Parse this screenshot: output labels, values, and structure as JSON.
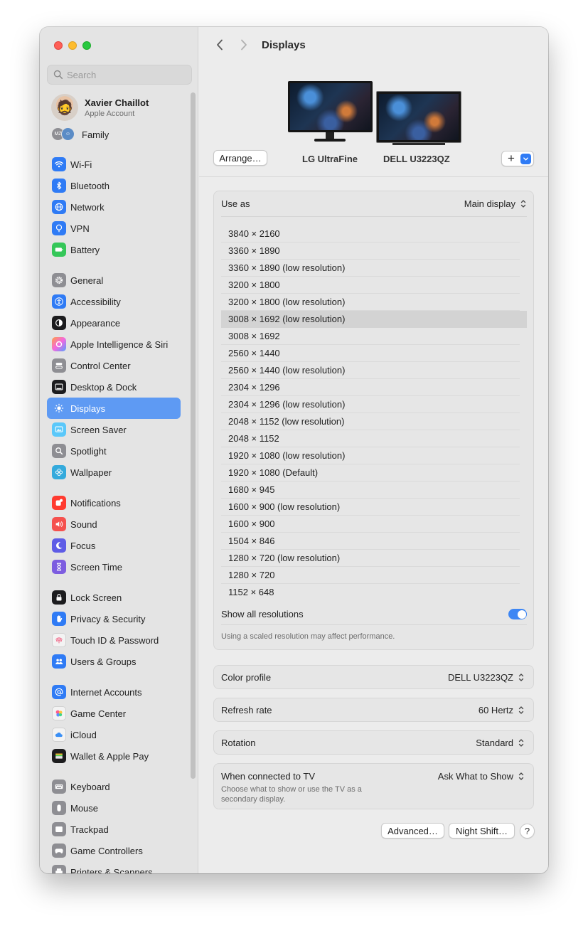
{
  "sidebar": {
    "search_placeholder": "Search",
    "account": {
      "name": "Xavier Chaillot",
      "subtitle": "Apple Account"
    },
    "family": {
      "label": "Family",
      "avatar_initials": "MZ"
    },
    "items": [
      {
        "label": "Wi-Fi",
        "icon": "wifi-icon"
      },
      {
        "label": "Bluetooth",
        "icon": "bluetooth-icon"
      },
      {
        "label": "Network",
        "icon": "globe-icon"
      },
      {
        "label": "VPN",
        "icon": "vpn-icon"
      },
      {
        "label": "Battery",
        "icon": "battery-icon"
      },
      {
        "label": "General",
        "icon": "gear-icon"
      },
      {
        "label": "Accessibility",
        "icon": "accessibility-icon"
      },
      {
        "label": "Appearance",
        "icon": "appearance-icon"
      },
      {
        "label": "Apple Intelligence & Siri",
        "icon": "siri-icon"
      },
      {
        "label": "Control Center",
        "icon": "control-center-icon"
      },
      {
        "label": "Desktop & Dock",
        "icon": "dock-icon"
      },
      {
        "label": "Displays",
        "icon": "sun-icon",
        "selected": true
      },
      {
        "label": "Screen Saver",
        "icon": "screen-saver-icon"
      },
      {
        "label": "Spotlight",
        "icon": "magnifier-icon"
      },
      {
        "label": "Wallpaper",
        "icon": "wallpaper-icon"
      },
      {
        "label": "Notifications",
        "icon": "bell-icon"
      },
      {
        "label": "Sound",
        "icon": "speaker-icon"
      },
      {
        "label": "Focus",
        "icon": "moon-icon"
      },
      {
        "label": "Screen Time",
        "icon": "hourglass-icon"
      },
      {
        "label": "Lock Screen",
        "icon": "lock-icon"
      },
      {
        "label": "Privacy & Security",
        "icon": "hand-icon"
      },
      {
        "label": "Touch ID & Password",
        "icon": "fingerprint-icon"
      },
      {
        "label": "Users & Groups",
        "icon": "users-icon"
      },
      {
        "label": "Internet Accounts",
        "icon": "at-icon"
      },
      {
        "label": "Game Center",
        "icon": "game-center-icon"
      },
      {
        "label": "iCloud",
        "icon": "cloud-icon"
      },
      {
        "label": "Wallet & Apple Pay",
        "icon": "wallet-icon"
      },
      {
        "label": "Keyboard",
        "icon": "keyboard-icon"
      },
      {
        "label": "Mouse",
        "icon": "mouse-icon"
      },
      {
        "label": "Trackpad",
        "icon": "trackpad-icon"
      },
      {
        "label": "Game Controllers",
        "icon": "gamepad-icon"
      },
      {
        "label": "Printers & Scanners",
        "icon": "printer-icon"
      }
    ]
  },
  "main": {
    "title": "Displays",
    "arrange_label": "Arrange…",
    "add_label": "+",
    "monitors": [
      "LG UltraFine",
      "DELL U3223QZ"
    ],
    "use_as": {
      "label": "Use as",
      "value": "Main display"
    },
    "resolutions": [
      "3840 × 2160",
      "3360 × 1890",
      "3360 × 1890 (low resolution)",
      "3200 × 1800",
      "3200 × 1800 (low resolution)",
      "3008 × 1692 (low resolution)",
      "3008 × 1692",
      "2560 × 1440",
      "2560 × 1440 (low resolution)",
      "2304 × 1296",
      "2304 × 1296 (low resolution)",
      "2048 × 1152 (low resolution)",
      "2048 × 1152",
      "1920 × 1080 (low resolution)",
      "1920 × 1080 (Default)",
      "1680 × 945",
      "1600 × 900 (low resolution)",
      "1600 × 900",
      "1504 × 846",
      "1280 × 720 (low resolution)",
      "1280 × 720",
      "1152 × 648"
    ],
    "selected_resolution": "3008 × 1692 (low resolution)",
    "show_all": {
      "label": "Show all resolutions",
      "on": true
    },
    "note": "Using a scaled resolution may affect performance.",
    "color_profile": {
      "label": "Color profile",
      "value": "DELL U3223QZ"
    },
    "refresh_rate": {
      "label": "Refresh rate",
      "value": "60 Hertz"
    },
    "rotation": {
      "label": "Rotation",
      "value": "Standard"
    },
    "tv": {
      "label": "When connected to TV",
      "description": "Choose what to show or use the TV as a secondary display.",
      "value": "Ask What to Show"
    },
    "advanced_label": "Advanced…",
    "night_shift_label": "Night Shift…",
    "help_label": "?"
  },
  "colors": {
    "accent": "#2f7bf5",
    "selected_sidebar": "#5e9af3",
    "window_bg": "#ececec"
  }
}
